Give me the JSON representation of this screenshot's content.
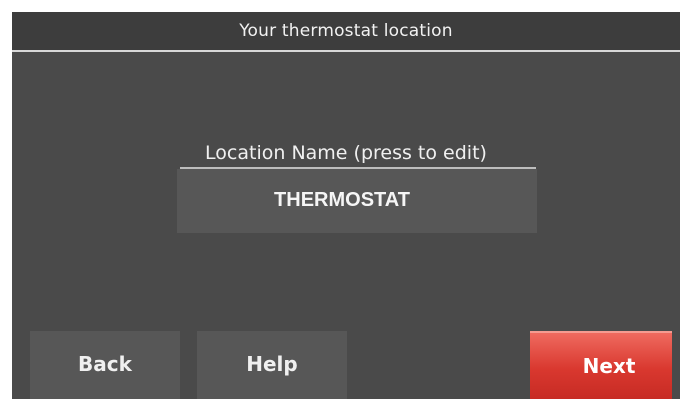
{
  "header": {
    "title": "Your thermostat location"
  },
  "location": {
    "label": "Location Name (press to edit)",
    "value": "THERMOSTAT"
  },
  "footer": {
    "back_label": "Back",
    "help_label": "Help",
    "next_label": "Next"
  },
  "colors": {
    "screen_background": "#4a4a4a",
    "button_background": "#575757",
    "next_button_accent": "#d9382f"
  }
}
